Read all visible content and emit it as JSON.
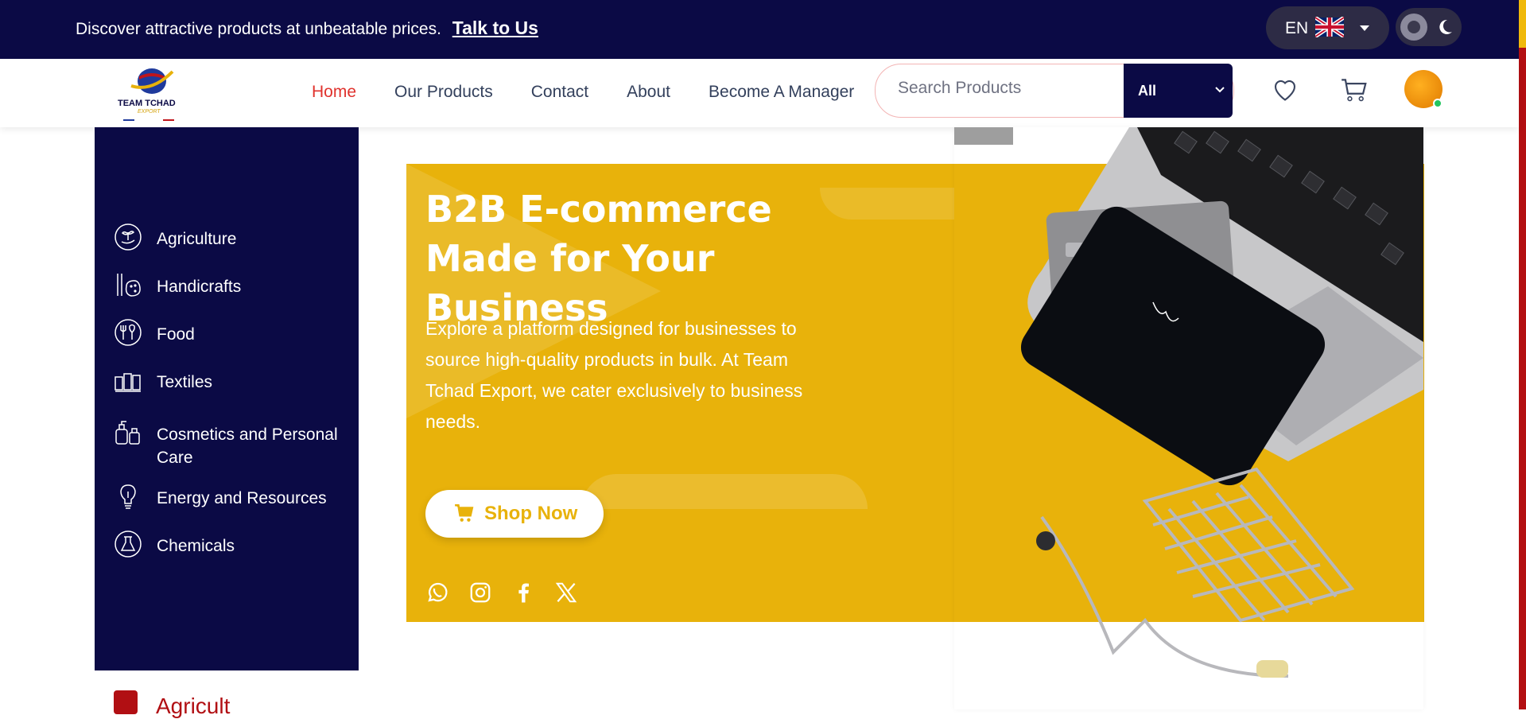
{
  "topbar": {
    "promo_text": "Discover attractive products at unbeatable prices.",
    "promo_link": "Talk to Us",
    "language": "EN"
  },
  "nav": {
    "logo_name": "TEAM TCHAD",
    "logo_sub": "EXPORT",
    "items": [
      {
        "label": "Home",
        "active": true
      },
      {
        "label": "Our Products"
      },
      {
        "label": "Contact"
      },
      {
        "label": "About"
      },
      {
        "label": "Become A Manager"
      }
    ],
    "search_placeholder": "Search Products",
    "category_filter": "All"
  },
  "categories": [
    {
      "label": "Agriculture",
      "icon": "agriculture-icon"
    },
    {
      "label": "Handicrafts",
      "icon": "handicrafts-icon"
    },
    {
      "label": "Food",
      "icon": "food-icon"
    },
    {
      "label": "Textiles",
      "icon": "textiles-icon"
    },
    {
      "label": "Cosmetics and Personal Care",
      "icon": "cosmetics-icon"
    },
    {
      "label": "Energy and Resources",
      "icon": "energy-icon"
    },
    {
      "label": "Chemicals",
      "icon": "chemicals-icon"
    }
  ],
  "below_section": {
    "label": "Agricult"
  },
  "hero": {
    "title": "B2B E-commerce Made for Your Business",
    "description": "Explore a platform designed for businesses to source high-quality products in bulk. At Team Tchad Export, we cater exclusively to business needs.",
    "cta": "Shop Now",
    "socials": [
      "whatsapp-icon",
      "instagram-icon",
      "facebook-icon",
      "x-icon"
    ]
  },
  "colors": {
    "navy": "#0b0a45",
    "accent_yellow": "#e8b20b",
    "active_red": "#e0322d"
  }
}
